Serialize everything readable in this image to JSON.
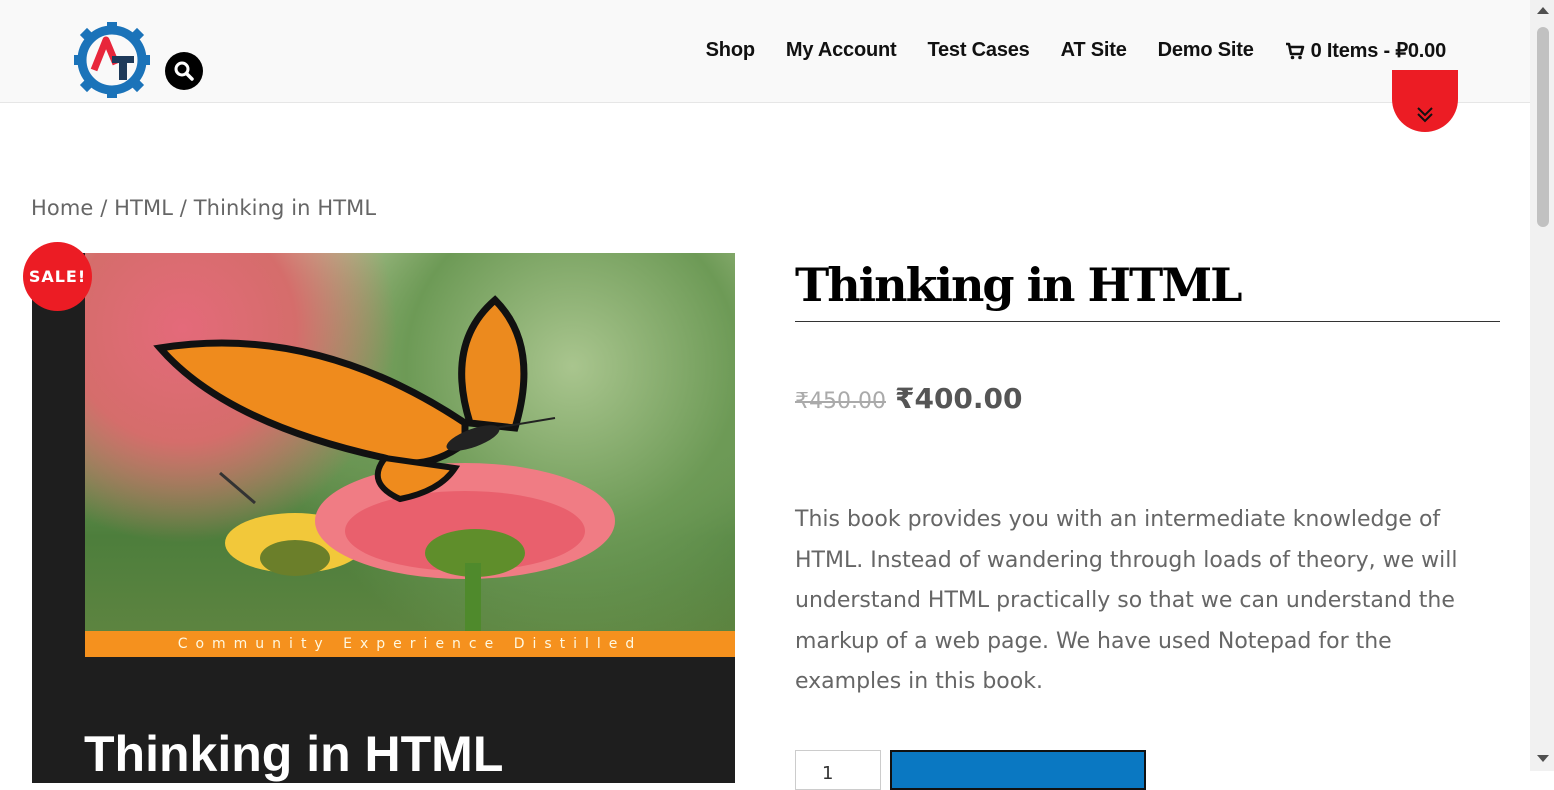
{
  "header": {
    "nav": [
      "Shop",
      "My Account",
      "Test Cases",
      "AT Site",
      "Demo Site"
    ],
    "cart_label": "0 Items - ₽0.00"
  },
  "icons": {
    "logo": "automationtesting-gear-logo",
    "search": "search-icon",
    "cart": "cart-icon",
    "scroll": "chevron-double-down-icon"
  },
  "colors": {
    "accent_red": "#ec1c24",
    "button_blue": "#0a78c2",
    "cover_orange": "#f5911e"
  },
  "breadcrumb": {
    "home": "Home",
    "sep1": " / ",
    "category": "HTML",
    "sep2": " / ",
    "current": "Thinking in HTML"
  },
  "product": {
    "sale_badge": "SALE!",
    "cover_band": "Community Experience Distilled",
    "cover_title": "Thinking in HTML",
    "title": "Thinking in HTML",
    "old_price": "₹450.00",
    "new_price": "₹400.00",
    "description": "This book provides you with an intermediate knowledge of HTML. Instead of wandering through loads of theory, we will understand HTML practically so that we can understand the markup of a web page. We have used Notepad for the examples in this book.",
    "quantity": "1"
  }
}
